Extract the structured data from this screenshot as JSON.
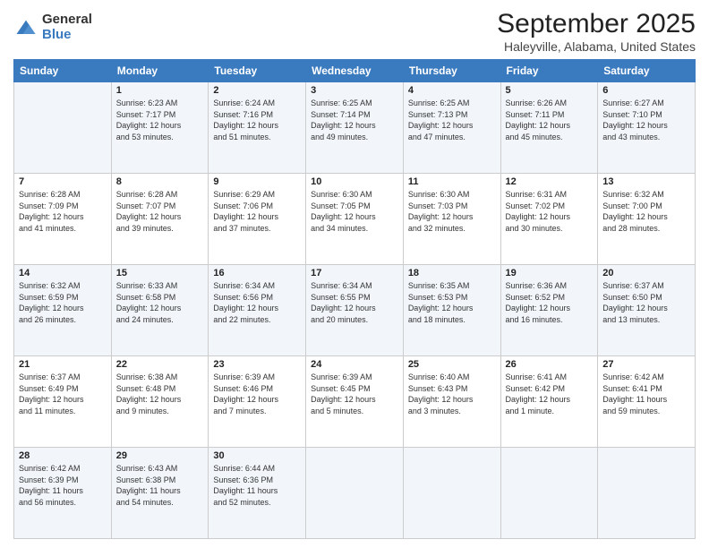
{
  "logo": {
    "general": "General",
    "blue": "Blue"
  },
  "title": "September 2025",
  "subtitle": "Haleyville, Alabama, United States",
  "days_of_week": [
    "Sunday",
    "Monday",
    "Tuesday",
    "Wednesday",
    "Thursday",
    "Friday",
    "Saturday"
  ],
  "weeks": [
    [
      {
        "day": "",
        "info": ""
      },
      {
        "day": "1",
        "info": "Sunrise: 6:23 AM\nSunset: 7:17 PM\nDaylight: 12 hours\nand 53 minutes."
      },
      {
        "day": "2",
        "info": "Sunrise: 6:24 AM\nSunset: 7:16 PM\nDaylight: 12 hours\nand 51 minutes."
      },
      {
        "day": "3",
        "info": "Sunrise: 6:25 AM\nSunset: 7:14 PM\nDaylight: 12 hours\nand 49 minutes."
      },
      {
        "day": "4",
        "info": "Sunrise: 6:25 AM\nSunset: 7:13 PM\nDaylight: 12 hours\nand 47 minutes."
      },
      {
        "day": "5",
        "info": "Sunrise: 6:26 AM\nSunset: 7:11 PM\nDaylight: 12 hours\nand 45 minutes."
      },
      {
        "day": "6",
        "info": "Sunrise: 6:27 AM\nSunset: 7:10 PM\nDaylight: 12 hours\nand 43 minutes."
      }
    ],
    [
      {
        "day": "7",
        "info": "Sunrise: 6:28 AM\nSunset: 7:09 PM\nDaylight: 12 hours\nand 41 minutes."
      },
      {
        "day": "8",
        "info": "Sunrise: 6:28 AM\nSunset: 7:07 PM\nDaylight: 12 hours\nand 39 minutes."
      },
      {
        "day": "9",
        "info": "Sunrise: 6:29 AM\nSunset: 7:06 PM\nDaylight: 12 hours\nand 37 minutes."
      },
      {
        "day": "10",
        "info": "Sunrise: 6:30 AM\nSunset: 7:05 PM\nDaylight: 12 hours\nand 34 minutes."
      },
      {
        "day": "11",
        "info": "Sunrise: 6:30 AM\nSunset: 7:03 PM\nDaylight: 12 hours\nand 32 minutes."
      },
      {
        "day": "12",
        "info": "Sunrise: 6:31 AM\nSunset: 7:02 PM\nDaylight: 12 hours\nand 30 minutes."
      },
      {
        "day": "13",
        "info": "Sunrise: 6:32 AM\nSunset: 7:00 PM\nDaylight: 12 hours\nand 28 minutes."
      }
    ],
    [
      {
        "day": "14",
        "info": "Sunrise: 6:32 AM\nSunset: 6:59 PM\nDaylight: 12 hours\nand 26 minutes."
      },
      {
        "day": "15",
        "info": "Sunrise: 6:33 AM\nSunset: 6:58 PM\nDaylight: 12 hours\nand 24 minutes."
      },
      {
        "day": "16",
        "info": "Sunrise: 6:34 AM\nSunset: 6:56 PM\nDaylight: 12 hours\nand 22 minutes."
      },
      {
        "day": "17",
        "info": "Sunrise: 6:34 AM\nSunset: 6:55 PM\nDaylight: 12 hours\nand 20 minutes."
      },
      {
        "day": "18",
        "info": "Sunrise: 6:35 AM\nSunset: 6:53 PM\nDaylight: 12 hours\nand 18 minutes."
      },
      {
        "day": "19",
        "info": "Sunrise: 6:36 AM\nSunset: 6:52 PM\nDaylight: 12 hours\nand 16 minutes."
      },
      {
        "day": "20",
        "info": "Sunrise: 6:37 AM\nSunset: 6:50 PM\nDaylight: 12 hours\nand 13 minutes."
      }
    ],
    [
      {
        "day": "21",
        "info": "Sunrise: 6:37 AM\nSunset: 6:49 PM\nDaylight: 12 hours\nand 11 minutes."
      },
      {
        "day": "22",
        "info": "Sunrise: 6:38 AM\nSunset: 6:48 PM\nDaylight: 12 hours\nand 9 minutes."
      },
      {
        "day": "23",
        "info": "Sunrise: 6:39 AM\nSunset: 6:46 PM\nDaylight: 12 hours\nand 7 minutes."
      },
      {
        "day": "24",
        "info": "Sunrise: 6:39 AM\nSunset: 6:45 PM\nDaylight: 12 hours\nand 5 minutes."
      },
      {
        "day": "25",
        "info": "Sunrise: 6:40 AM\nSunset: 6:43 PM\nDaylight: 12 hours\nand 3 minutes."
      },
      {
        "day": "26",
        "info": "Sunrise: 6:41 AM\nSunset: 6:42 PM\nDaylight: 12 hours\nand 1 minute."
      },
      {
        "day": "27",
        "info": "Sunrise: 6:42 AM\nSunset: 6:41 PM\nDaylight: 11 hours\nand 59 minutes."
      }
    ],
    [
      {
        "day": "28",
        "info": "Sunrise: 6:42 AM\nSunset: 6:39 PM\nDaylight: 11 hours\nand 56 minutes."
      },
      {
        "day": "29",
        "info": "Sunrise: 6:43 AM\nSunset: 6:38 PM\nDaylight: 11 hours\nand 54 minutes."
      },
      {
        "day": "30",
        "info": "Sunrise: 6:44 AM\nSunset: 6:36 PM\nDaylight: 11 hours\nand 52 minutes."
      },
      {
        "day": "",
        "info": ""
      },
      {
        "day": "",
        "info": ""
      },
      {
        "day": "",
        "info": ""
      },
      {
        "day": "",
        "info": ""
      }
    ]
  ]
}
